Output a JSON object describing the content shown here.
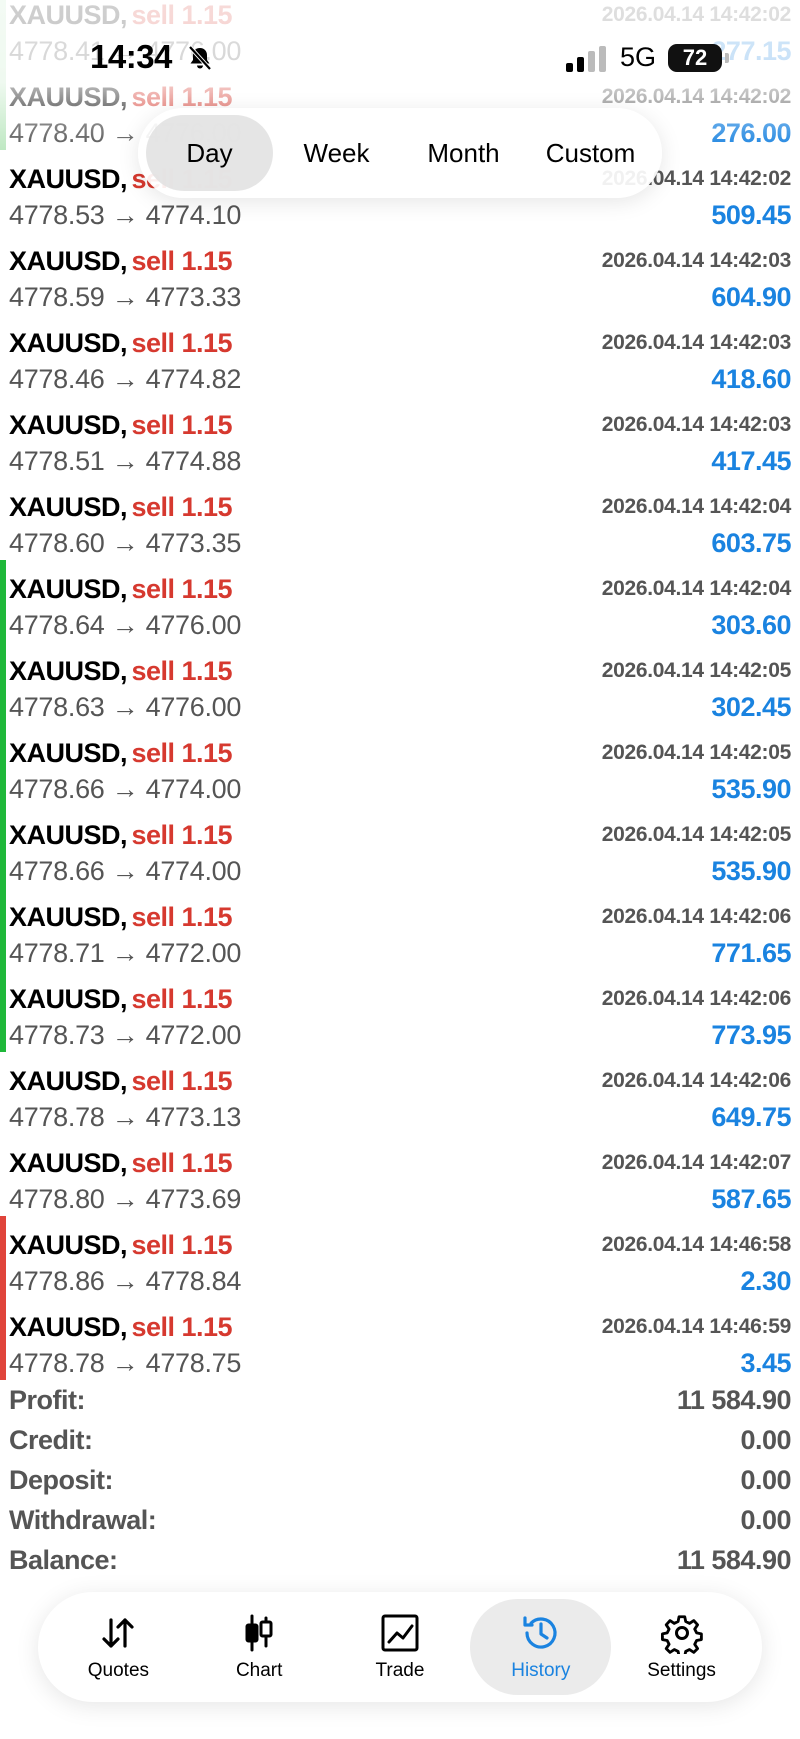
{
  "status_bar": {
    "time": "14:34",
    "network": "5G",
    "battery": "72"
  },
  "period_tabs": [
    {
      "label": "Day",
      "active": true
    },
    {
      "label": "Week",
      "active": false
    },
    {
      "label": "Month",
      "active": false
    },
    {
      "label": "Custom",
      "active": false
    }
  ],
  "deals": [
    {
      "symbol": "XAUUSD,",
      "side": "sell 1.15",
      "time": "2026.04.14 14:42:02",
      "prices": "4778.41 → 4776.00",
      "profit": "277.15",
      "marker": "lightgreen"
    },
    {
      "symbol": "XAUUSD,",
      "side": "sell 1.15",
      "time": "2026.04.14 14:42:02",
      "prices": "4778.40 → 4776.00",
      "profit": "276.00",
      "marker": "lightgreen"
    },
    {
      "symbol": "XAUUSD,",
      "side": "sell 1.15",
      "time": "2026.04.14 14:42:02",
      "prices": "4778.53 → 4774.10",
      "profit": "509.45",
      "marker": "none"
    },
    {
      "symbol": "XAUUSD,",
      "side": "sell 1.15",
      "time": "2026.04.14 14:42:03",
      "prices": "4778.59 → 4773.33",
      "profit": "604.90",
      "marker": "none"
    },
    {
      "symbol": "XAUUSD,",
      "side": "sell 1.15",
      "time": "2026.04.14 14:42:03",
      "prices": "4778.46 → 4774.82",
      "profit": "418.60",
      "marker": "none"
    },
    {
      "symbol": "XAUUSD,",
      "side": "sell 1.15",
      "time": "2026.04.14 14:42:03",
      "prices": "4778.51 → 4774.88",
      "profit": "417.45",
      "marker": "none"
    },
    {
      "symbol": "XAUUSD,",
      "side": "sell 1.15",
      "time": "2026.04.14 14:42:04",
      "prices": "4778.60 → 4773.35",
      "profit": "603.75",
      "marker": "none"
    },
    {
      "symbol": "XAUUSD,",
      "side": "sell 1.15",
      "time": "2026.04.14 14:42:04",
      "prices": "4778.64 → 4776.00",
      "profit": "303.60",
      "marker": "green"
    },
    {
      "symbol": "XAUUSD,",
      "side": "sell 1.15",
      "time": "2026.04.14 14:42:05",
      "prices": "4778.63 → 4776.00",
      "profit": "302.45",
      "marker": "green"
    },
    {
      "symbol": "XAUUSD,",
      "side": "sell 1.15",
      "time": "2026.04.14 14:42:05",
      "prices": "4778.66 → 4774.00",
      "profit": "535.90",
      "marker": "green"
    },
    {
      "symbol": "XAUUSD,",
      "side": "sell 1.15",
      "time": "2026.04.14 14:42:05",
      "prices": "4778.66 → 4774.00",
      "profit": "535.90",
      "marker": "green"
    },
    {
      "symbol": "XAUUSD,",
      "side": "sell 1.15",
      "time": "2026.04.14 14:42:06",
      "prices": "4778.71 → 4772.00",
      "profit": "771.65",
      "marker": "green"
    },
    {
      "symbol": "XAUUSD,",
      "side": "sell 1.15",
      "time": "2026.04.14 14:42:06",
      "prices": "4778.73 → 4772.00",
      "profit": "773.95",
      "marker": "green"
    },
    {
      "symbol": "XAUUSD,",
      "side": "sell 1.15",
      "time": "2026.04.14 14:42:06",
      "prices": "4778.78 → 4773.13",
      "profit": "649.75",
      "marker": "none"
    },
    {
      "symbol": "XAUUSD,",
      "side": "sell 1.15",
      "time": "2026.04.14 14:42:07",
      "prices": "4778.80 → 4773.69",
      "profit": "587.65",
      "marker": "none"
    },
    {
      "symbol": "XAUUSD,",
      "side": "sell 1.15",
      "time": "2026.04.14 14:46:58",
      "prices": "4778.86 → 4778.84",
      "profit": "2.30",
      "marker": "red"
    },
    {
      "symbol": "XAUUSD,",
      "side": "sell 1.15",
      "time": "2026.04.14 14:46:59",
      "prices": "4778.78 → 4778.75",
      "profit": "3.45",
      "marker": "red"
    }
  ],
  "summary": [
    {
      "label": "Profit:",
      "value": "11 584.90"
    },
    {
      "label": "Credit:",
      "value": "0.00"
    },
    {
      "label": "Deposit:",
      "value": "0.00"
    },
    {
      "label": "Withdrawal:",
      "value": "0.00"
    },
    {
      "label": "Balance:",
      "value": "11 584.90"
    }
  ],
  "tabs": [
    {
      "label": "Quotes",
      "icon": "quotes-arrows-icon",
      "active": false
    },
    {
      "label": "Chart",
      "icon": "candlestick-icon",
      "active": false
    },
    {
      "label": "Trade",
      "icon": "trade-chart-icon",
      "active": false
    },
    {
      "label": "History",
      "icon": "history-clock-icon",
      "active": true
    },
    {
      "label": "Settings",
      "icon": "gear-icon",
      "active": false
    }
  ],
  "colors": {
    "sell": "#d6392f",
    "profit": "#1a83e0",
    "active_tab": "#1a83e0",
    "marker_green": "#1fb83a",
    "marker_red": "#e0443b"
  }
}
